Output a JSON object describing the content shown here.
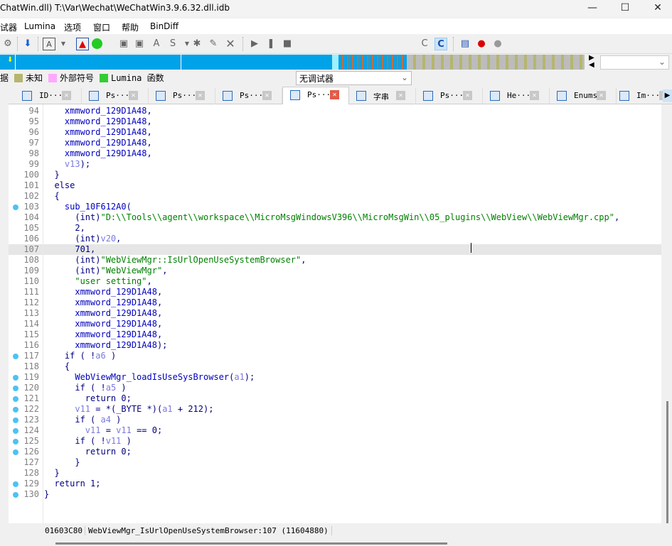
{
  "window": {
    "title": "ChatWin.dll) T:\\Var\\Wechat\\WeChatWin3.9.6.32.dll.idb"
  },
  "menu": [
    "试器",
    "Lumina",
    "选项",
    "窗口",
    "帮助",
    "BinDiff"
  ],
  "toolbar": {
    "debugger_select": "无调试器"
  },
  "legend": [
    {
      "label": "据",
      "color": ""
    },
    {
      "label": "未知",
      "color": "#b5b56e"
    },
    {
      "label": "外部符号",
      "color": "#ffa8ff"
    },
    {
      "label": "Lumina 函数",
      "color": "#33cc33"
    }
  ],
  "tabs": [
    {
      "label": "ID···"
    },
    {
      "label": "Ps···"
    },
    {
      "label": "Ps···"
    },
    {
      "label": "Ps···"
    },
    {
      "label": "Ps···",
      "active": true
    },
    {
      "label": "字串"
    },
    {
      "label": "Ps···"
    },
    {
      "label": "He···"
    },
    {
      "label": "Enums"
    },
    {
      "label": "Im···"
    }
  ],
  "code": {
    "current_line": 107,
    "lines": [
      {
        "n": 94,
        "t": [
          [
            "    "
          ],
          [
            "xmmword_129D1A48",
            "f"
          ],
          [
            ",",
            "k"
          ]
        ]
      },
      {
        "n": 95,
        "t": [
          [
            "    "
          ],
          [
            "xmmword_129D1A48",
            "f"
          ],
          [
            ",",
            "k"
          ]
        ]
      },
      {
        "n": 96,
        "t": [
          [
            "    "
          ],
          [
            "xmmword_129D1A48",
            "f"
          ],
          [
            ",",
            "k"
          ]
        ]
      },
      {
        "n": 97,
        "t": [
          [
            "    "
          ],
          [
            "xmmword_129D1A48",
            "f"
          ],
          [
            ",",
            "k"
          ]
        ]
      },
      {
        "n": 98,
        "t": [
          [
            "    "
          ],
          [
            "xmmword_129D1A48",
            "f"
          ],
          [
            ",",
            "k"
          ]
        ]
      },
      {
        "n": 99,
        "t": [
          [
            "    "
          ],
          [
            "v13",
            "v"
          ],
          [
            ");",
            "k"
          ]
        ]
      },
      {
        "n": 100,
        "t": [
          [
            "  "
          ],
          [
            "}",
            "k"
          ]
        ]
      },
      {
        "n": 101,
        "t": [
          [
            "  "
          ],
          [
            "else",
            "k"
          ]
        ]
      },
      {
        "n": 102,
        "t": [
          [
            "  "
          ],
          [
            "{",
            "k"
          ]
        ]
      },
      {
        "n": 103,
        "bp": true,
        "t": [
          [
            "    "
          ],
          [
            "sub_10F612A0",
            "f"
          ],
          [
            "(",
            "k"
          ]
        ]
      },
      {
        "n": 104,
        "t": [
          [
            "      "
          ],
          [
            "(int)",
            "k"
          ],
          [
            "\"D:\\\\Tools\\\\agent\\\\workspace\\\\MicroMsgWindowsV396\\\\MicroMsgWin\\\\05_plugins\\\\WebView\\\\WebViewMgr.cpp\"",
            "s"
          ],
          [
            ",",
            "k"
          ]
        ]
      },
      {
        "n": 105,
        "t": [
          [
            "      "
          ],
          [
            "2,",
            "k"
          ]
        ]
      },
      {
        "n": 106,
        "t": [
          [
            "      "
          ],
          [
            "(int)",
            "k"
          ],
          [
            "v20",
            "v"
          ],
          [
            ",",
            "k"
          ]
        ]
      },
      {
        "n": 107,
        "t": [
          [
            "      "
          ],
          [
            "701,",
            "k"
          ]
        ]
      },
      {
        "n": 108,
        "t": [
          [
            "      "
          ],
          [
            "(int)",
            "k"
          ],
          [
            "\"WebViewMgr::IsUrlOpenUseSystemBrowser\"",
            "s"
          ],
          [
            ",",
            "k"
          ]
        ]
      },
      {
        "n": 109,
        "t": [
          [
            "      "
          ],
          [
            "(int)",
            "k"
          ],
          [
            "\"WebViewMgr\"",
            "s"
          ],
          [
            ",",
            "k"
          ]
        ]
      },
      {
        "n": 110,
        "t": [
          [
            "      "
          ],
          [
            "\"user setting\"",
            "s"
          ],
          [
            ",",
            "k"
          ]
        ]
      },
      {
        "n": 111,
        "t": [
          [
            "      "
          ],
          [
            "xmmword_129D1A48",
            "f"
          ],
          [
            ",",
            "k"
          ]
        ]
      },
      {
        "n": 112,
        "t": [
          [
            "      "
          ],
          [
            "xmmword_129D1A48",
            "f"
          ],
          [
            ",",
            "k"
          ]
        ]
      },
      {
        "n": 113,
        "t": [
          [
            "      "
          ],
          [
            "xmmword_129D1A48",
            "f"
          ],
          [
            ",",
            "k"
          ]
        ]
      },
      {
        "n": 114,
        "t": [
          [
            "      "
          ],
          [
            "xmmword_129D1A48",
            "f"
          ],
          [
            ",",
            "k"
          ]
        ]
      },
      {
        "n": 115,
        "t": [
          [
            "      "
          ],
          [
            "xmmword_129D1A48",
            "f"
          ],
          [
            ",",
            "k"
          ]
        ]
      },
      {
        "n": 116,
        "t": [
          [
            "      "
          ],
          [
            "xmmword_129D1A48",
            "f"
          ],
          [
            ");",
            "k"
          ]
        ]
      },
      {
        "n": 117,
        "bp": true,
        "t": [
          [
            "    "
          ],
          [
            "if ( !",
            "k"
          ],
          [
            "a6",
            "v"
          ],
          [
            " )",
            "k"
          ]
        ]
      },
      {
        "n": 118,
        "t": [
          [
            "    "
          ],
          [
            "{",
            "k"
          ]
        ]
      },
      {
        "n": 119,
        "bp": true,
        "t": [
          [
            "      "
          ],
          [
            "WebViewMgr_loadIsUseSysBrowser",
            "f"
          ],
          [
            "(",
            "k"
          ],
          [
            "a1",
            "v"
          ],
          [
            ");",
            "k"
          ]
        ]
      },
      {
        "n": 120,
        "bp": true,
        "t": [
          [
            "      "
          ],
          [
            "if ( !",
            "k"
          ],
          [
            "a5",
            "v"
          ],
          [
            " )",
            "k"
          ]
        ]
      },
      {
        "n": 121,
        "bp": true,
        "t": [
          [
            "        "
          ],
          [
            "return 0;",
            "k"
          ]
        ]
      },
      {
        "n": 122,
        "bp": true,
        "t": [
          [
            "      "
          ],
          [
            "v11",
            "v"
          ],
          [
            " = *(_BYTE *)(",
            "k"
          ],
          [
            "a1",
            "v"
          ],
          [
            " + 212);",
            "k"
          ]
        ]
      },
      {
        "n": 123,
        "bp": true,
        "t": [
          [
            "      "
          ],
          [
            "if ( ",
            "k"
          ],
          [
            "a4",
            "v"
          ],
          [
            " )",
            "k"
          ]
        ]
      },
      {
        "n": 124,
        "bp": true,
        "t": [
          [
            "        "
          ],
          [
            "v11",
            "v"
          ],
          [
            " = ",
            "k"
          ],
          [
            "v11",
            "v"
          ],
          [
            " == 0;",
            "k"
          ]
        ]
      },
      {
        "n": 125,
        "bp": true,
        "t": [
          [
            "      "
          ],
          [
            "if ( !",
            "k"
          ],
          [
            "v11",
            "v"
          ],
          [
            " )",
            "k"
          ]
        ]
      },
      {
        "n": 126,
        "bp": true,
        "t": [
          [
            "        "
          ],
          [
            "return 0;",
            "k"
          ]
        ]
      },
      {
        "n": 127,
        "t": [
          [
            "      "
          ],
          [
            "}",
            "k"
          ]
        ]
      },
      {
        "n": 128,
        "t": [
          [
            "  "
          ],
          [
            "}",
            "k"
          ]
        ]
      },
      {
        "n": 129,
        "bp": true,
        "t": [
          [
            "  "
          ],
          [
            "return 1;",
            "k"
          ]
        ]
      },
      {
        "n": 130,
        "bp": true,
        "t": [
          [
            "}",
            "k"
          ]
        ]
      }
    ]
  },
  "status": {
    "address": "01603C80",
    "location": "WebViewMgr_IsUrlOpenUseSystemBrowser:107 (11604880)"
  }
}
